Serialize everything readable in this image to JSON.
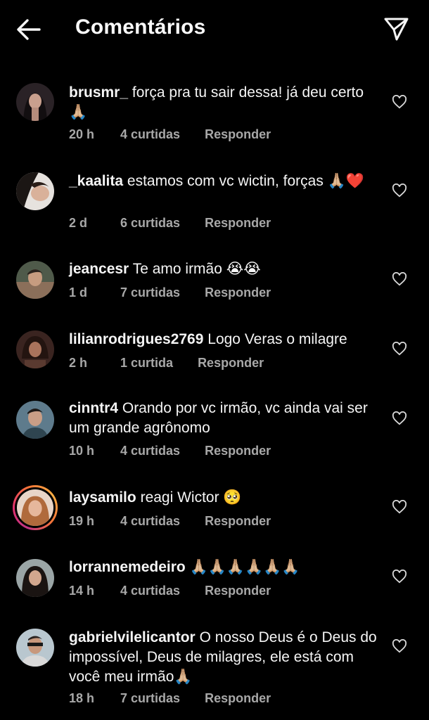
{
  "header": {
    "title": "Comentários",
    "back_icon": "arrow-left-icon",
    "share_icon": "send-icon"
  },
  "colors": {
    "background": "#000000",
    "text": "#f5f5f5",
    "meta": "#a8a8a8",
    "story_ring": "#e1306c"
  },
  "comments": [
    {
      "user": "brusmr_",
      "text": "força pra tu sair dessa! já deu certo 🙏🏼",
      "time": "20 h",
      "likes": "4 curtidas",
      "reply": "Responder"
    },
    {
      "user": "_kaalita",
      "text": "estamos com vc wictin, forças 🙏🏼❤️",
      "time": "2 d",
      "likes": "6 curtidas",
      "reply": "Responder"
    },
    {
      "user": "jeancesr",
      "text": "Te amo irmão 😭😭",
      "time": "1 d",
      "likes": "7 curtidas",
      "reply": "Responder"
    },
    {
      "user": "lilianrodrigues2769",
      "text": "Logo Veras o milagre",
      "time": "2 h",
      "likes": "1 curtida",
      "reply": "Responder"
    },
    {
      "user": "cinntr4",
      "text": "Orando por vc irmão, vc ainda vai ser um grande agrônomo",
      "time": "10 h",
      "likes": "4 curtidas",
      "reply": "Responder"
    },
    {
      "user": "laysamilo",
      "text": "reagi Wictor 🥺",
      "time": "19 h",
      "likes": "4 curtidas",
      "reply": "Responder"
    },
    {
      "user": "lorrannemedeiro",
      "text": "🙏🏼🙏🏼🙏🏼🙏🏼🙏🏼🙏🏼",
      "time": "14 h",
      "likes": "4 curtidas",
      "reply": "Responder"
    },
    {
      "user": "gabrielvilelicantor",
      "text": "O nosso Deus é o Deus do impossível, Deus de milagres, ele está com você meu irmão🙏🏼",
      "time": "18 h",
      "likes": "7 curtidas",
      "reply": "Responder"
    }
  ]
}
